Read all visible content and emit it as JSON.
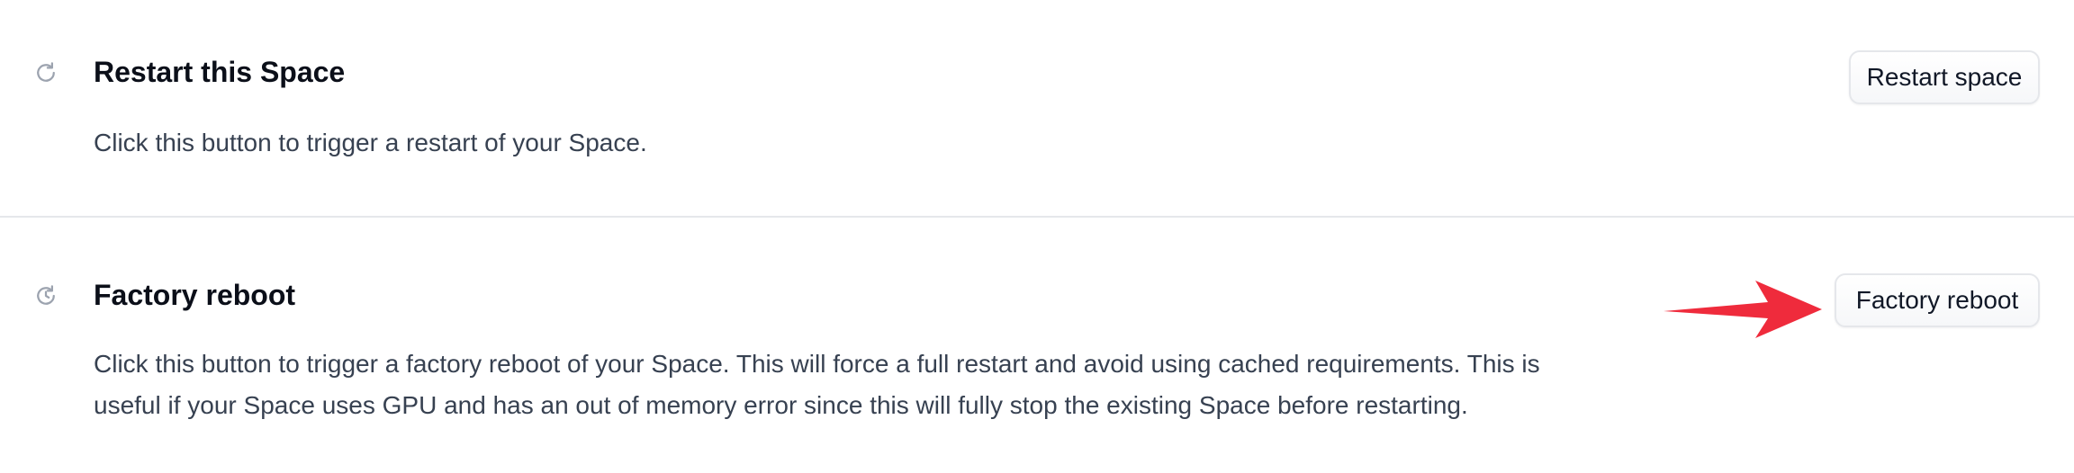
{
  "restart_section": {
    "icon": "refresh-icon",
    "title": "Restart this Space",
    "description": "Click this button to trigger a restart of your Space.",
    "button_label": "Restart space"
  },
  "factory_section": {
    "icon": "refresh-clock-icon",
    "title": "Factory reboot",
    "description": "Click this button to trigger a factory reboot of your Space. This will force a full restart and avoid using cached requirements. This is useful if your Space uses GPU and has an out of memory error since this will fully stop the existing Space before restarting.",
    "button_label": "Factory reboot"
  },
  "annotation": {
    "icon": "red-arrow-icon",
    "color": "#ef2b3c"
  }
}
